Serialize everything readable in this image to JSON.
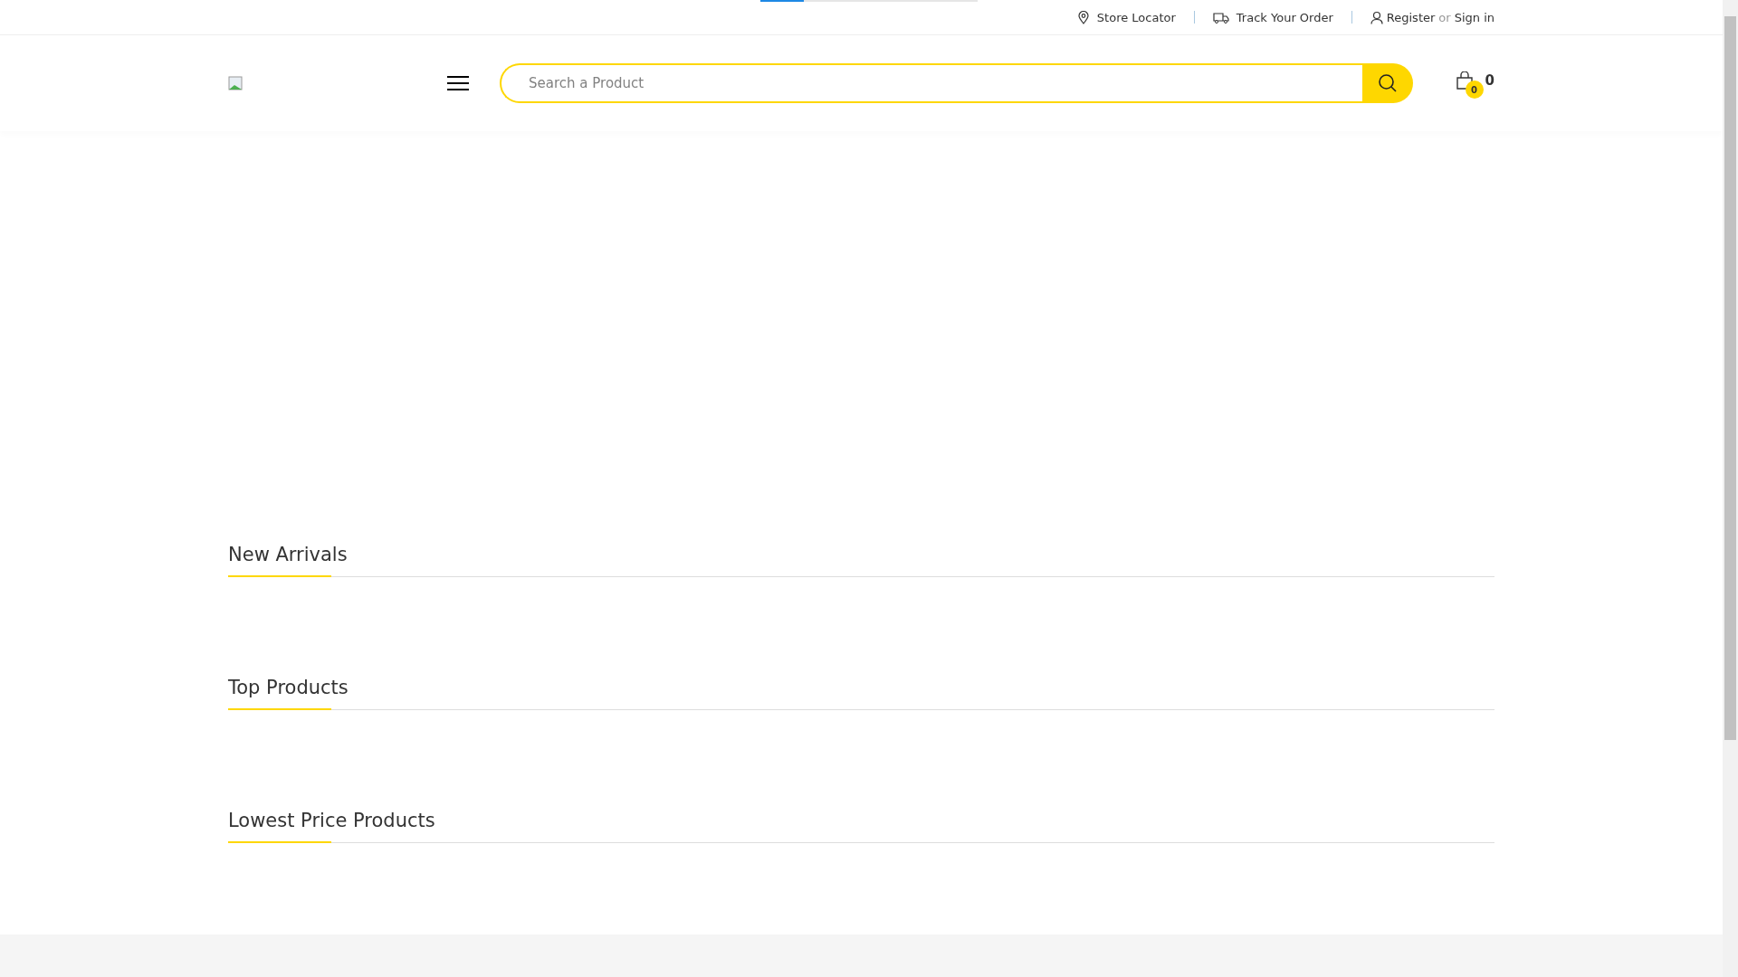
{
  "loading_bar": {
    "level": 0.2
  },
  "top_links": [
    {
      "kind": "location",
      "label": "Store Locator"
    },
    {
      "kind": "truck",
      "label": "Track Your Order"
    },
    {
      "kind": "account",
      "label": "Register",
      "separator": "or",
      "label2": "Sign in"
    }
  ],
  "search": {
    "placeholder": "Search a Product"
  },
  "cart": {
    "badge": "0",
    "count": "0"
  },
  "sections": [
    {
      "title": "New Arrivals"
    },
    {
      "title": "Top Products"
    },
    {
      "title": "Lowest Price Products"
    }
  ]
}
